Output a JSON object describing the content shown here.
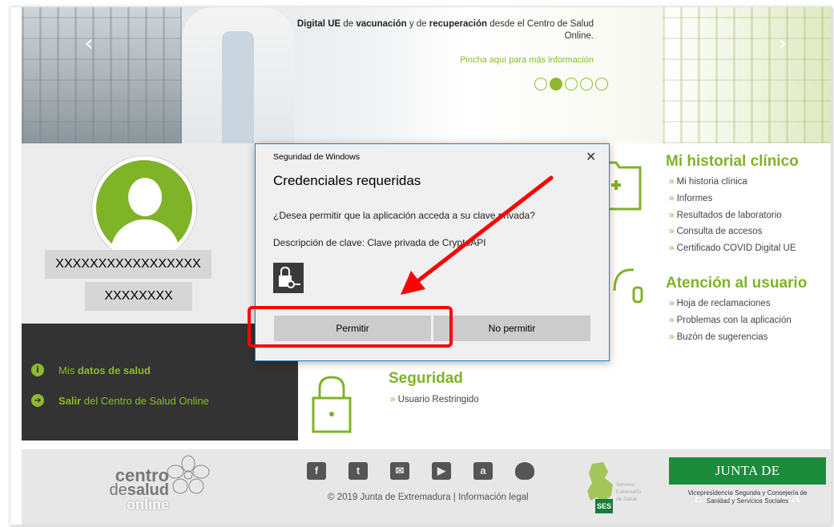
{
  "hero": {
    "text_part1": "Digital UE",
    "text_part2": " de ",
    "text_part3": "vacunación",
    "text_part4": " y de ",
    "text_part5": "recuperación",
    "text_part6": " desde el Centro de Salud Online.",
    "link": "Pincha aquí para más información",
    "slide_count": 5,
    "active_slide": 2
  },
  "user": {
    "name_line1": "XXXXXXXXXXXXXXXXX",
    "name_line2": "XXXXXXXX"
  },
  "side_menu": {
    "item1_a": "Mis ",
    "item1_b": "datos de salud",
    "item2_a": "Salir",
    "item2_b": " del Centro de Salud Online"
  },
  "historial": {
    "title": "Mi historial clínico",
    "links": [
      "Mi historia clínica",
      "Informes",
      "Resultados de laboratorio",
      "Consulta de accesos",
      "Certificado COVID Digital UE"
    ]
  },
  "atencion": {
    "title": "Atención al usuario",
    "links": [
      "Hoja de reclamaciones",
      "Problemas con la aplicación",
      "Buzón de sugerencias"
    ]
  },
  "seguridad": {
    "title": "Seguridad",
    "links": [
      "Usuario Restringido"
    ]
  },
  "dialog": {
    "caption": "Seguridad de Windows",
    "close": "✕",
    "title": "Credenciales requeridas",
    "question": "¿Desea permitir que la aplicación acceda a su clave privada?",
    "description": "Descripción de clave: Clave privada de CryptoAPI",
    "permit_label": "Permitir",
    "deny_label": "No permitir"
  },
  "footer": {
    "logo_l1": "centro",
    "logo_l2a": "de",
    "logo_l2b": "salud",
    "logo_l3": "online",
    "socials": [
      "facebook-icon",
      "twitter-icon",
      "email-icon",
      "youtube-icon",
      "android-icon",
      "apple-icon"
    ],
    "copyright": "© 2019 Junta de Extremadura | Información legal",
    "ses_badge": "SES",
    "ses_text_l1": "Servicio",
    "ses_text_l2": "Extremeño",
    "ses_text_l3": "de Salud",
    "junta": "JUNTA DE EXTREMADURA",
    "junta_sub_l1": "Vicepresidencia Segunda y Consejería de",
    "junta_sub_l2": "Sanidad y Servicios Sociales"
  },
  "colors": {
    "brand_green": "#7fb328",
    "annotation_red": "#ff0000",
    "dark_panel": "#333333",
    "junta_green": "#1c8c3c"
  }
}
